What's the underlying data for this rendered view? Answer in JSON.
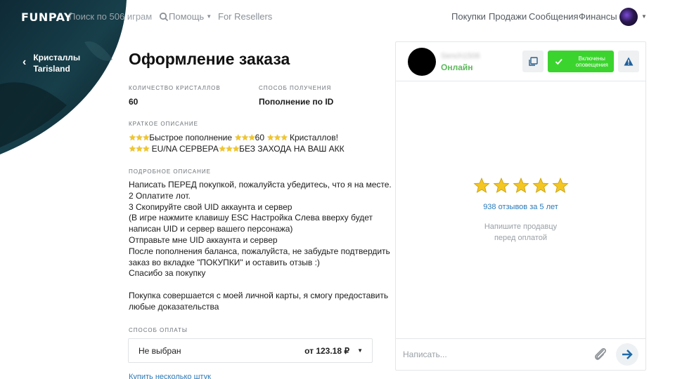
{
  "header": {
    "logo": "FUNPAY",
    "search_placeholder": "Поиск по 506 играм",
    "help_label": "Помощь",
    "resellers_label": "For Resellers",
    "nav": [
      "Покупки",
      "Продажи",
      "Сообщения",
      "Финансы"
    ]
  },
  "breadcrumb": {
    "category": "Кристаллы",
    "game": "Tarisland"
  },
  "order": {
    "title": "Оформление заказа",
    "quantity_label": "КОЛИЧЕСТВО КРИСТАЛЛОВ",
    "quantity_value": "60",
    "method_label": "СПОСОБ ПОЛУЧЕНИЯ",
    "method_value": "Пополнение по ID",
    "short_label": "КРАТКОЕ ОПИСАНИЕ",
    "short_line1_a": "Быстрое пополнение",
    "short_line1_b": "60",
    "short_line1_c": "Кристаллов!",
    "short_line2_a": "EU/NA СЕРВЕРА",
    "short_line2_b": "БЕЗ ЗАХОДА НА ВАШ АКК",
    "long_label": "ПОДРОБНОЕ ОПИСАНИЕ",
    "long_lines": [
      "Написать ПЕРЕД покупкой, пожалуйста убедитесь, что я на месте.",
      "2 Оплатите лот.",
      "3 Скопируйте свой UID аккаунта и сервер",
      "(В игре нажмите клавишу ESC Настройка Слева вверху будет",
      "написан UID и сервер вашего персонажа)",
      "Отправьте мне UID аккаунта и сервер",
      "После пополнения баланса, пожалуйста, не забудьте подтвердить",
      "заказ во вкладке \"ПОКУПКИ\" и оставить отзыв :)",
      "Спасибо за покупку",
      "",
      "Покупка совершается с моей личной карты, я смогу предоставить",
      "любые доказательства"
    ],
    "payment_label": "СПОСОБ ОПЛАТЫ",
    "payment_value": "Не выбран",
    "payment_price": "от 123.18 ₽",
    "multi_link": "Купить несколько штук"
  },
  "seller": {
    "name": "Sench1506",
    "status": "Онлайн",
    "notifications_label": "Включены оповещения",
    "rating_stars": 5,
    "reviews": "938 отзывов за 5 лет",
    "hint_line1": "Напишите продавцу",
    "hint_line2": "перед оплатой",
    "message_placeholder": "Написать..."
  },
  "colors": {
    "accent_green": "#3bd42e",
    "online_green": "#5cb85c",
    "star": "#f3c623",
    "link": "#2a7ab8"
  }
}
